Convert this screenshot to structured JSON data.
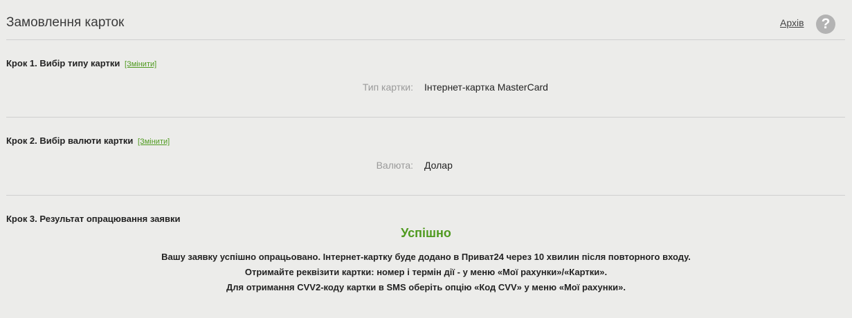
{
  "header": {
    "title": "Замовлення карток",
    "archive_label": "Архів",
    "help_glyph": "?"
  },
  "step1": {
    "title": "Крок 1. Вибір типу картки",
    "change_label": "[Змінити]",
    "field_label": "Тип картки:",
    "field_value": "Інтернет-картка MasterCard"
  },
  "step2": {
    "title": "Крок 2. Вибір валюти картки",
    "change_label": "[Змінити]",
    "field_label": "Валюта:",
    "field_value": "Долар"
  },
  "step3": {
    "title": "Крок 3. Результат опрацювання заявки",
    "status": "Успішно",
    "message_lines": [
      "Вашу заявку успішно опрацьовано. Інтернет-картку буде додано в Приват24 через 10 хвилин після повторного входу.",
      "Отримайте реквізити картки: номер і термін дії - у меню «Мої рахунки»/«Картки».",
      "Для отримання CVV2-коду картки в SMS оберіть опцію «Код CVV» у меню «Мої рахунки»."
    ]
  },
  "colors": {
    "accent_green": "#4f9a1f",
    "background": "#ececea",
    "help_icon": "#b3b3b3"
  }
}
